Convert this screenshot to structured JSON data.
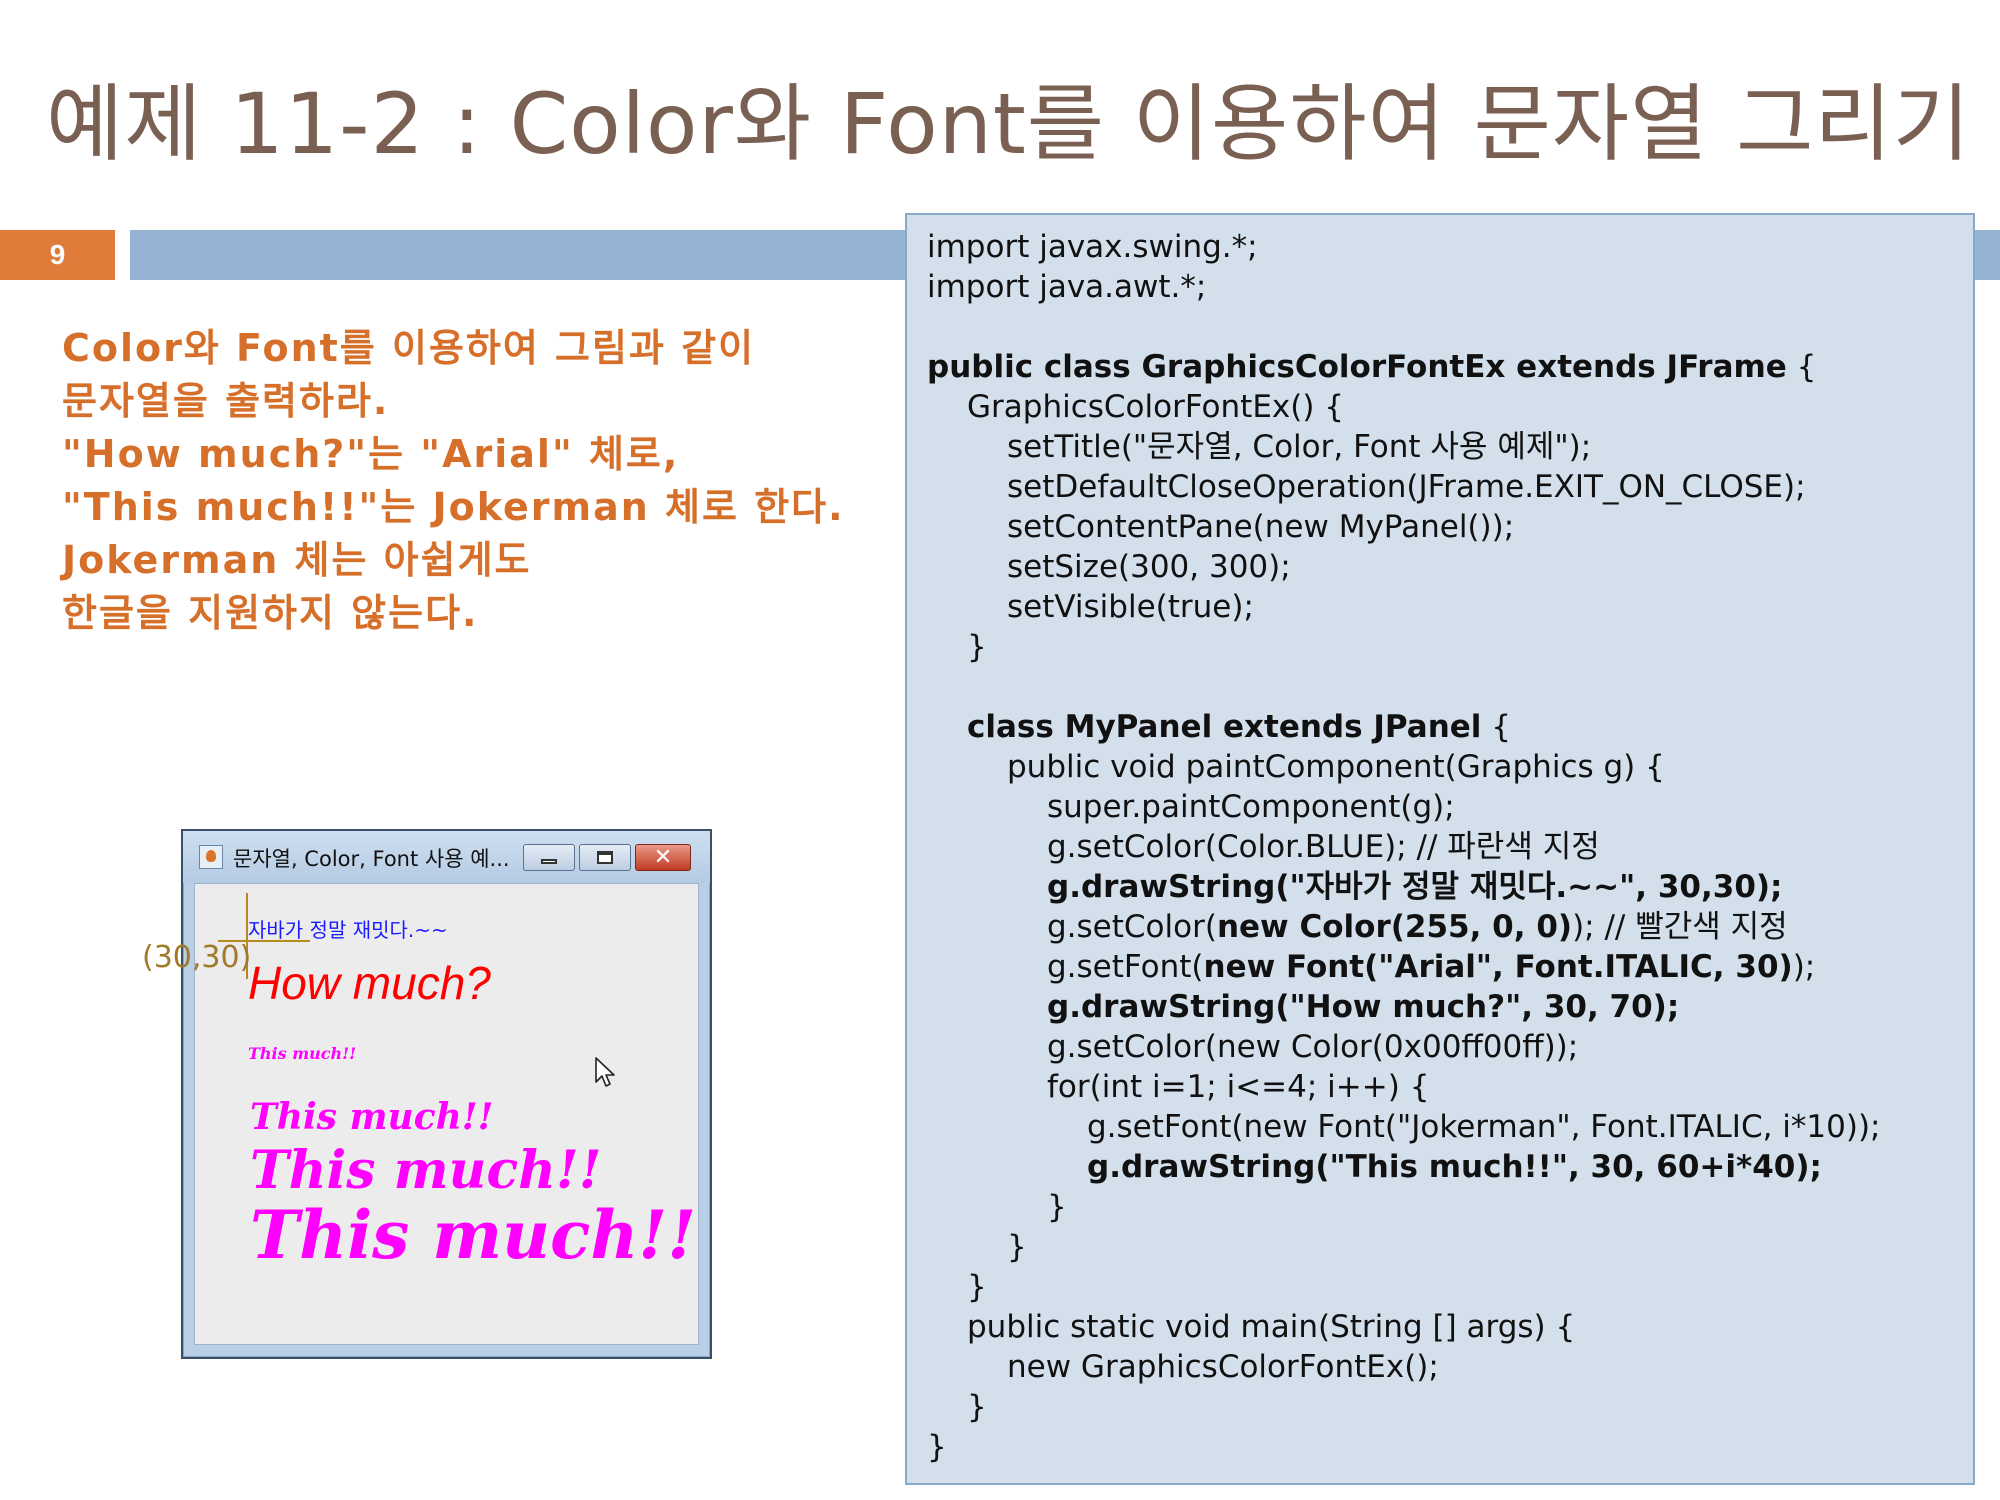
{
  "slide": {
    "title": "예제 11-2 : Color와 Font를 이용하여 문자열 그리기",
    "page_number": "9"
  },
  "instructions": [
    "Color와 Font를 이용하여 그림과 같이",
    "문자열을 출력하라.",
    "\"How much?\"는 \"Arial\" 체로,",
    "\"This much!!\"는 Jokerman 체로 한다.",
    "Jokerman 체는 아쉽게도",
    "한글을 지원하지 않는다."
  ],
  "code_lines": [
    {
      "indent": 0,
      "segments": [
        {
          "t": "import javax.swing.*;",
          "b": false
        }
      ]
    },
    {
      "indent": 0,
      "segments": [
        {
          "t": "import java.awt.*;",
          "b": false
        }
      ]
    },
    {
      "indent": 0,
      "segments": []
    },
    {
      "indent": 0,
      "segments": [
        {
          "t": "public class GraphicsColorFontEx extends JFrame",
          "b": true
        },
        {
          "t": " {",
          "b": false
        }
      ]
    },
    {
      "indent": 1,
      "segments": [
        {
          "t": "GraphicsColorFontEx() {",
          "b": false
        }
      ]
    },
    {
      "indent": 2,
      "segments": [
        {
          "t": "setTitle(\"문자열, Color, Font 사용 예제\");",
          "b": false
        }
      ]
    },
    {
      "indent": 2,
      "segments": [
        {
          "t": "setDefaultCloseOperation(JFrame.EXIT_ON_CLOSE);",
          "b": false
        }
      ]
    },
    {
      "indent": 2,
      "segments": [
        {
          "t": "setContentPane(new MyPanel());",
          "b": false
        }
      ]
    },
    {
      "indent": 2,
      "segments": [
        {
          "t": "setSize(300, 300);",
          "b": false
        }
      ]
    },
    {
      "indent": 2,
      "segments": [
        {
          "t": "setVisible(true);",
          "b": false
        }
      ]
    },
    {
      "indent": 1,
      "segments": [
        {
          "t": "}",
          "b": false
        }
      ]
    },
    {
      "indent": 0,
      "segments": []
    },
    {
      "indent": 1,
      "segments": [
        {
          "t": "class MyPanel extends JPanel",
          "b": true
        },
        {
          "t": " {",
          "b": false
        }
      ]
    },
    {
      "indent": 2,
      "segments": [
        {
          "t": "public void paintComponent(Graphics g) {",
          "b": false
        }
      ]
    },
    {
      "indent": 3,
      "segments": [
        {
          "t": "super.paintComponent(g);",
          "b": false
        }
      ]
    },
    {
      "indent": 3,
      "segments": [
        {
          "t": "g.setColor(Color.BLUE); // 파란색 지정",
          "b": false
        }
      ]
    },
    {
      "indent": 3,
      "segments": [
        {
          "t": "g.drawString(\"자바가 정말 재밋다.~~\", 30,30);",
          "b": true
        }
      ]
    },
    {
      "indent": 3,
      "segments": [
        {
          "t": "g.setColor(",
          "b": false
        },
        {
          "t": "new Color(255, 0, 0)",
          "b": true
        },
        {
          "t": "); // 빨간색 지정",
          "b": false
        }
      ]
    },
    {
      "indent": 3,
      "segments": [
        {
          "t": "g.setFont(",
          "b": false
        },
        {
          "t": "new Font(\"Arial\", Font.ITALIC, 30)",
          "b": true
        },
        {
          "t": ");",
          "b": false
        }
      ]
    },
    {
      "indent": 3,
      "segments": [
        {
          "t": "g.drawString(\"How much?\", 30, 70);",
          "b": true
        }
      ]
    },
    {
      "indent": 3,
      "segments": [
        {
          "t": "g.setColor(new Color(0x00ff00ff));",
          "b": false
        }
      ]
    },
    {
      "indent": 3,
      "segments": [
        {
          "t": "for(int i=1; i<=4; i++) {",
          "b": false
        }
      ]
    },
    {
      "indent": 4,
      "segments": [
        {
          "t": "g.setFont(new Font(\"Jokerman\", Font.ITALIC, i*10));",
          "b": false
        }
      ]
    },
    {
      "indent": 4,
      "segments": [
        {
          "t": "g.drawString(\"This much!!\", 30, 60+i*40);",
          "b": true
        }
      ]
    },
    {
      "indent": 3,
      "segments": [
        {
          "t": "}",
          "b": false
        }
      ]
    },
    {
      "indent": 2,
      "segments": [
        {
          "t": "}",
          "b": false
        }
      ]
    },
    {
      "indent": 1,
      "segments": [
        {
          "t": "}",
          "b": false
        }
      ]
    },
    {
      "indent": 1,
      "segments": [
        {
          "t": "public static void main(String [] args) {",
          "b": false
        }
      ]
    },
    {
      "indent": 2,
      "segments": [
        {
          "t": "new GraphicsColorFontEx();",
          "b": false
        }
      ]
    },
    {
      "indent": 1,
      "segments": [
        {
          "t": "}",
          "b": false
        }
      ]
    },
    {
      "indent": 0,
      "segments": [
        {
          "t": "}",
          "b": false
        }
      ]
    }
  ],
  "java_window": {
    "title": "문자열, Color, Font 사용  예...",
    "close_symbol": "✕",
    "blue_text": "자바가 정말 재밋다.~~",
    "red_text": "How much?",
    "magenta_text": "This much!!",
    "magenta_copies": 4,
    "origin_label": "(30,30)",
    "colors": {
      "blue": "#0000ff",
      "red": "#ff0000",
      "magenta": "#ff00ff"
    }
  },
  "icons": [
    "java-app-icon",
    "minimize-icon",
    "maximize-icon",
    "close-icon",
    "mouse-cursor-icon"
  ],
  "colors": {
    "title": "#7a6052",
    "accent": "#e07b39",
    "header_bar": "#95b3d3",
    "instructions": "#d56f2a",
    "code_panel": "#d3e0ec"
  }
}
